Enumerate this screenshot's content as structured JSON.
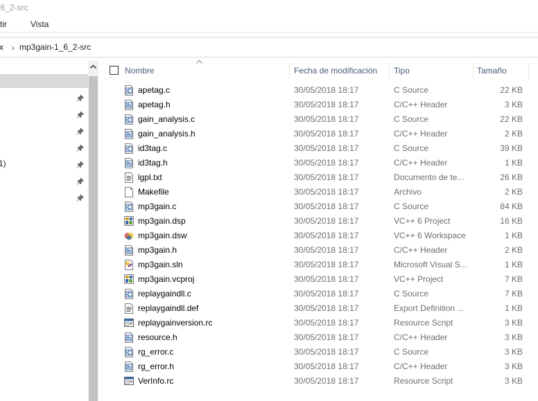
{
  "window": {
    "title": "_6_2-src"
  },
  "ribbon": {
    "tabs": [
      "rtir",
      "Vista"
    ]
  },
  "address": {
    "crumbs": [
      "x",
      "mp3gain-1_6_2-src"
    ]
  },
  "nav": {
    "partial_text": "1)"
  },
  "columns": {
    "name": "Nombre",
    "date": "Fecha de modificación",
    "type": "Tipo",
    "size": "Tamaño"
  },
  "files": [
    {
      "name": "apetag.c",
      "date": "30/05/2018 18:17",
      "type": "C Source",
      "size": "22 KB",
      "icon": "c-source-icon"
    },
    {
      "name": "apetag.h",
      "date": "30/05/2018 18:17",
      "type": "C/C++ Header",
      "size": "3 KB",
      "icon": "header-icon"
    },
    {
      "name": "gain_analysis.c",
      "date": "30/05/2018 18:17",
      "type": "C Source",
      "size": "22 KB",
      "icon": "c-source-icon"
    },
    {
      "name": "gain_analysis.h",
      "date": "30/05/2018 18:17",
      "type": "C/C++ Header",
      "size": "2 KB",
      "icon": "header-icon"
    },
    {
      "name": "id3tag.c",
      "date": "30/05/2018 18:17",
      "type": "C Source",
      "size": "39 KB",
      "icon": "c-source-icon"
    },
    {
      "name": "id3tag.h",
      "date": "30/05/2018 18:17",
      "type": "C/C++ Header",
      "size": "1 KB",
      "icon": "header-icon"
    },
    {
      "name": "lgpl.txt",
      "date": "30/05/2018 18:17",
      "type": "Documento de te...",
      "size": "26 KB",
      "icon": "text-file-icon"
    },
    {
      "name": "Makefile",
      "date": "30/05/2018 18:17",
      "type": "Archivo",
      "size": "2 KB",
      "icon": "blank-file-icon"
    },
    {
      "name": "mp3gain.c",
      "date": "30/05/2018 18:17",
      "type": "C Source",
      "size": "84 KB",
      "icon": "c-source-icon"
    },
    {
      "name": "mp3gain.dsp",
      "date": "30/05/2018 18:17",
      "type": "VC++ 6 Project",
      "size": "16 KB",
      "icon": "project-icon"
    },
    {
      "name": "mp3gain.dsw",
      "date": "30/05/2018 18:17",
      "type": "VC++ 6 Workspace",
      "size": "1 KB",
      "icon": "workspace-icon"
    },
    {
      "name": "mp3gain.h",
      "date": "30/05/2018 18:17",
      "type": "C/C++ Header",
      "size": "2 KB",
      "icon": "header-icon"
    },
    {
      "name": "mp3gain.sln",
      "date": "30/05/2018 18:17",
      "type": "Microsoft Visual S...",
      "size": "1 KB",
      "icon": "solution-icon"
    },
    {
      "name": "mp3gain.vcproj",
      "date": "30/05/2018 18:17",
      "type": "VC++ Project",
      "size": "7 KB",
      "icon": "project-icon"
    },
    {
      "name": "replaygaindll.c",
      "date": "30/05/2018 18:17",
      "type": "C Source",
      "size": "7 KB",
      "icon": "c-source-icon"
    },
    {
      "name": "replaygaindll.def",
      "date": "30/05/2018 18:17",
      "type": "Export Definition ...",
      "size": "1 KB",
      "icon": "text-file-icon"
    },
    {
      "name": "replaygainversion.rc",
      "date": "30/05/2018 18:17",
      "type": "Resource Script",
      "size": "3 KB",
      "icon": "resource-icon"
    },
    {
      "name": "resource.h",
      "date": "30/05/2018 18:17",
      "type": "C/C++ Header",
      "size": "3 KB",
      "icon": "header-icon"
    },
    {
      "name": "rg_error.c",
      "date": "30/05/2018 18:17",
      "type": "C Source",
      "size": "3 KB",
      "icon": "c-source-icon"
    },
    {
      "name": "rg_error.h",
      "date": "30/05/2018 18:17",
      "type": "C/C++ Header",
      "size": "3 KB",
      "icon": "header-icon"
    },
    {
      "name": "VerInfo.rc",
      "date": "30/05/2018 18:17",
      "type": "Resource Script",
      "size": "3 KB",
      "icon": "resource-icon"
    }
  ],
  "colors": {
    "selection": "#d9d9d9",
    "header_text": "#4a5a7a",
    "meta_text": "#6d6d6d",
    "scrollbar_thumb": "#c2c2c2"
  }
}
